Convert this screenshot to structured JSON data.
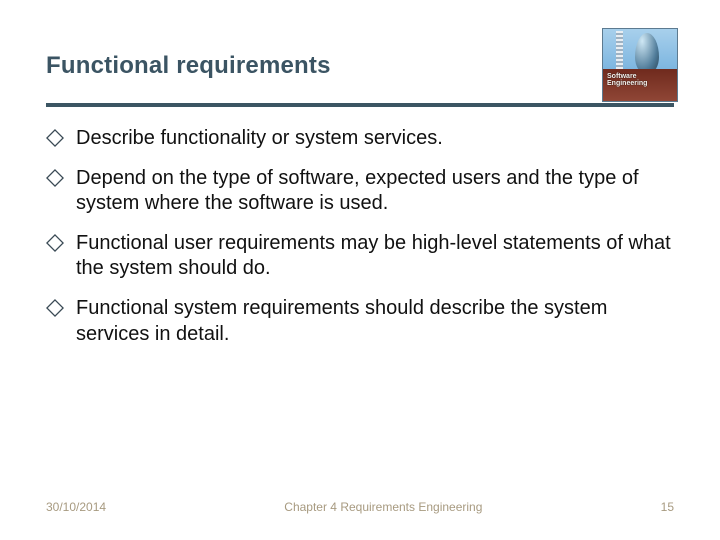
{
  "title": "Functional requirements",
  "logo": {
    "line1": "Software Engineering",
    "line2": ""
  },
  "bullets": [
    "Describe functionality or system services.",
    "Depend on the type of software, expected users and the type of system where the software is used.",
    "Functional user requirements may be high-level statements of what the system should do.",
    "Functional system requirements should describe the system services in detail."
  ],
  "footer": {
    "date": "30/10/2014",
    "chapter": "Chapter 4 Requirements Engineering",
    "page": "15"
  },
  "colors": {
    "heading": "#3b5463",
    "rule": "#3b5563",
    "footer": "#a79a80"
  }
}
